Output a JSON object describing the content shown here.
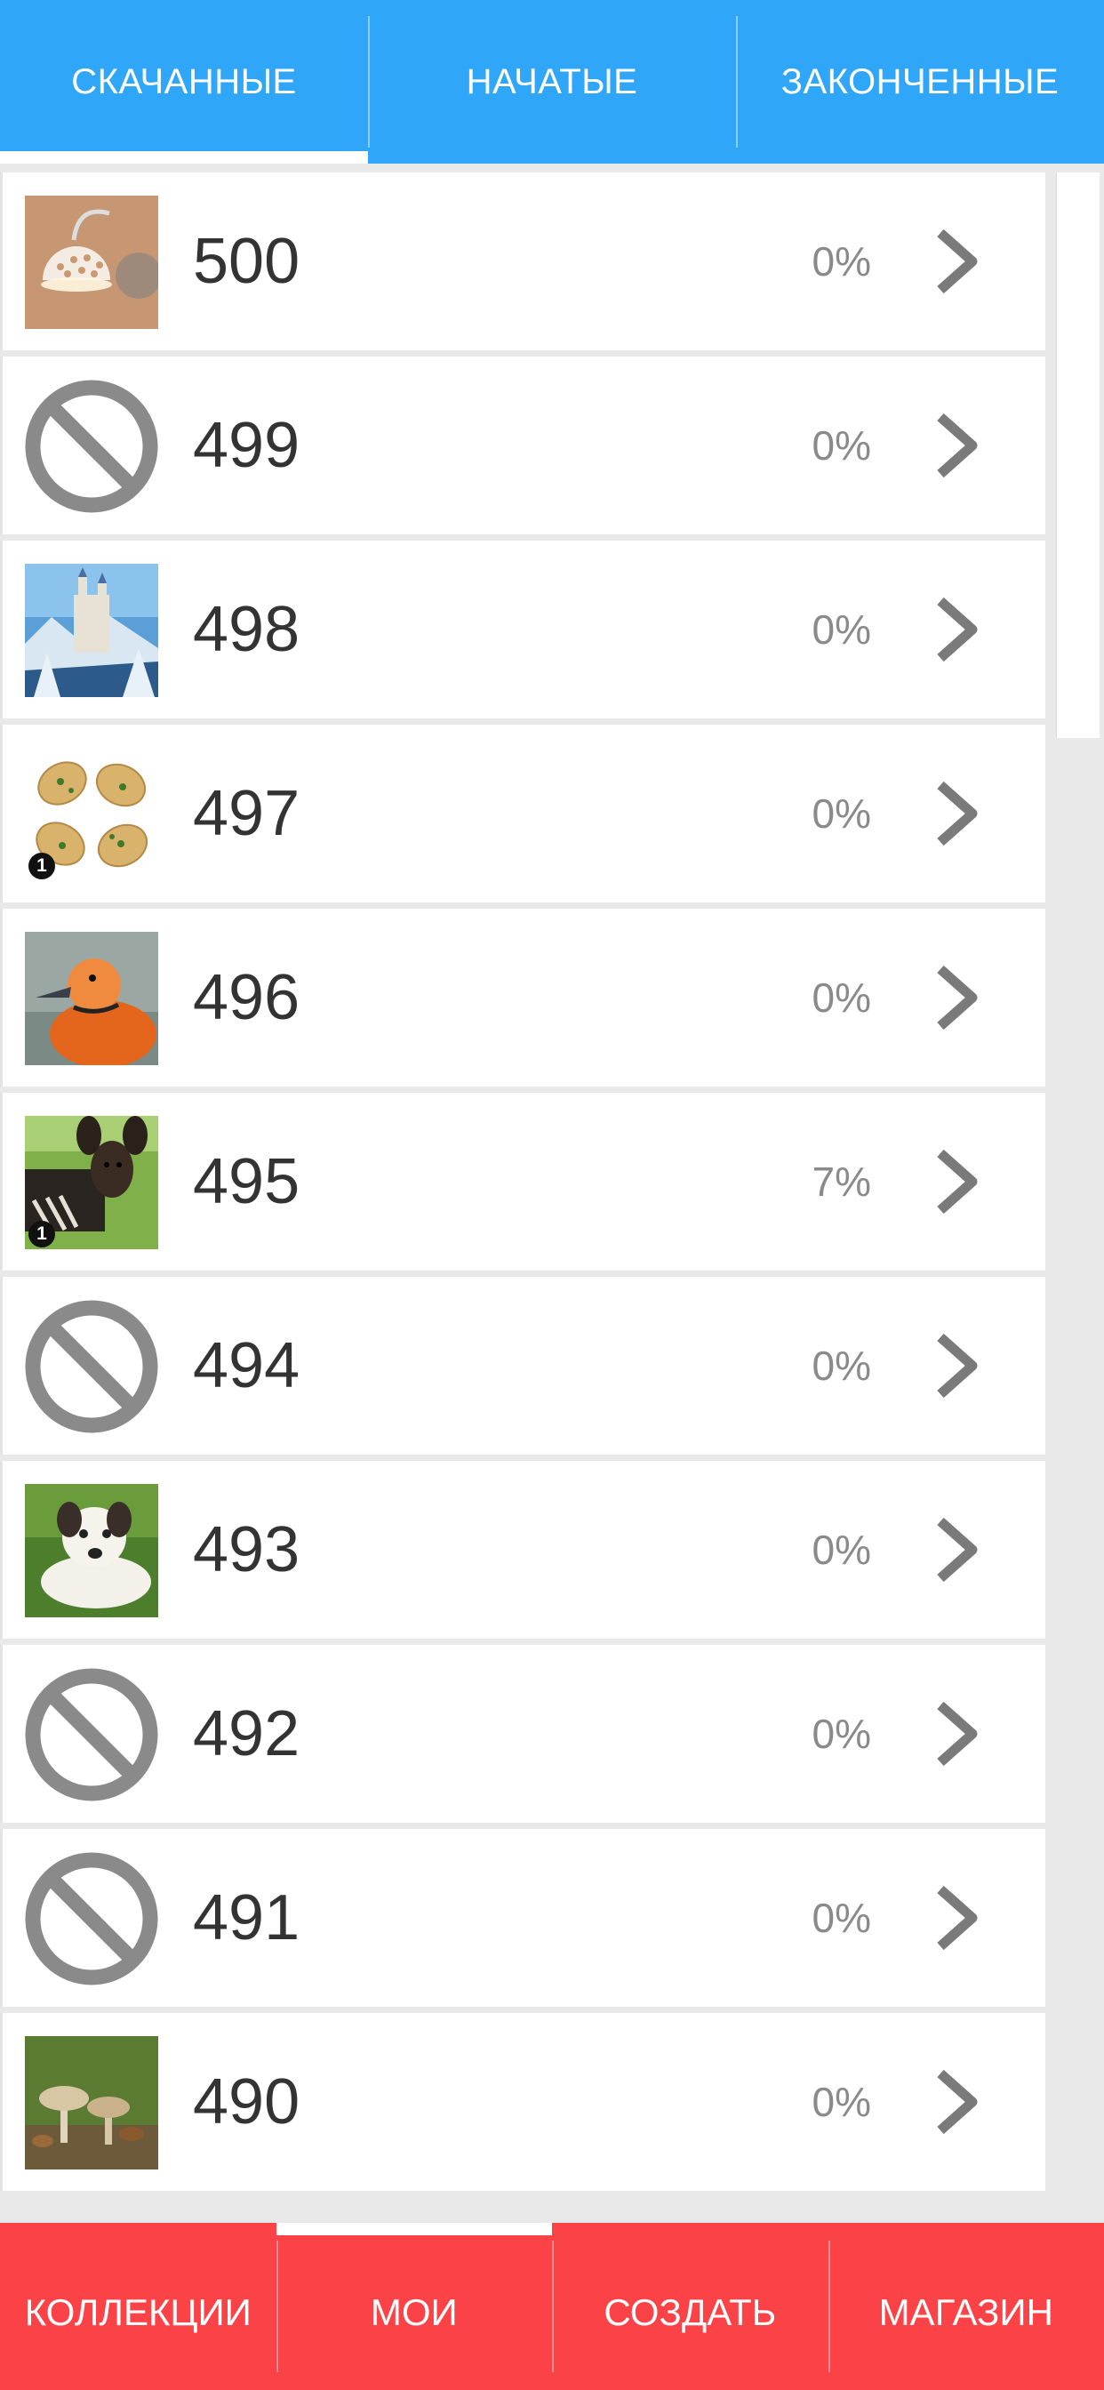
{
  "top_tabs": [
    {
      "label": "СКАЧАННЫЕ",
      "active": true
    },
    {
      "label": "НАЧАТЫЕ",
      "active": false
    },
    {
      "label": "ЗАКОНЧЕННЫЕ",
      "active": false
    }
  ],
  "puzzles": [
    {
      "number": "500",
      "progress": "0%",
      "thumb": "lamp-image",
      "badge": ""
    },
    {
      "number": "499",
      "progress": "0%",
      "thumb": "unavailable-icon",
      "badge": ""
    },
    {
      "number": "498",
      "progress": "0%",
      "thumb": "castle-image",
      "badge": ""
    },
    {
      "number": "497",
      "progress": "0%",
      "thumb": "food-image",
      "badge": "1"
    },
    {
      "number": "496",
      "progress": "0%",
      "thumb": "duck-image",
      "badge": ""
    },
    {
      "number": "495",
      "progress": "7%",
      "thumb": "okapi-image",
      "badge": "1"
    },
    {
      "number": "494",
      "progress": "0%",
      "thumb": "unavailable-icon",
      "badge": ""
    },
    {
      "number": "493",
      "progress": "0%",
      "thumb": "puppy-image",
      "badge": ""
    },
    {
      "number": "492",
      "progress": "0%",
      "thumb": "unavailable-icon",
      "badge": ""
    },
    {
      "number": "491",
      "progress": "0%",
      "thumb": "unavailable-icon",
      "badge": ""
    },
    {
      "number": "490",
      "progress": "0%",
      "thumb": "mushrooms-image",
      "badge": ""
    }
  ],
  "bottom_nav": [
    {
      "label": "КОЛЛЕКЦИИ",
      "active": false
    },
    {
      "label": "МОИ",
      "active": true
    },
    {
      "label": "СОЗДАТЬ",
      "active": false
    },
    {
      "label": "МАГАЗИН",
      "active": false
    }
  ],
  "colors": {
    "top_bar": "#30a6f8",
    "bottom_bar": "#fb4347",
    "text": "#333333",
    "muted": "#8a8a8a"
  }
}
